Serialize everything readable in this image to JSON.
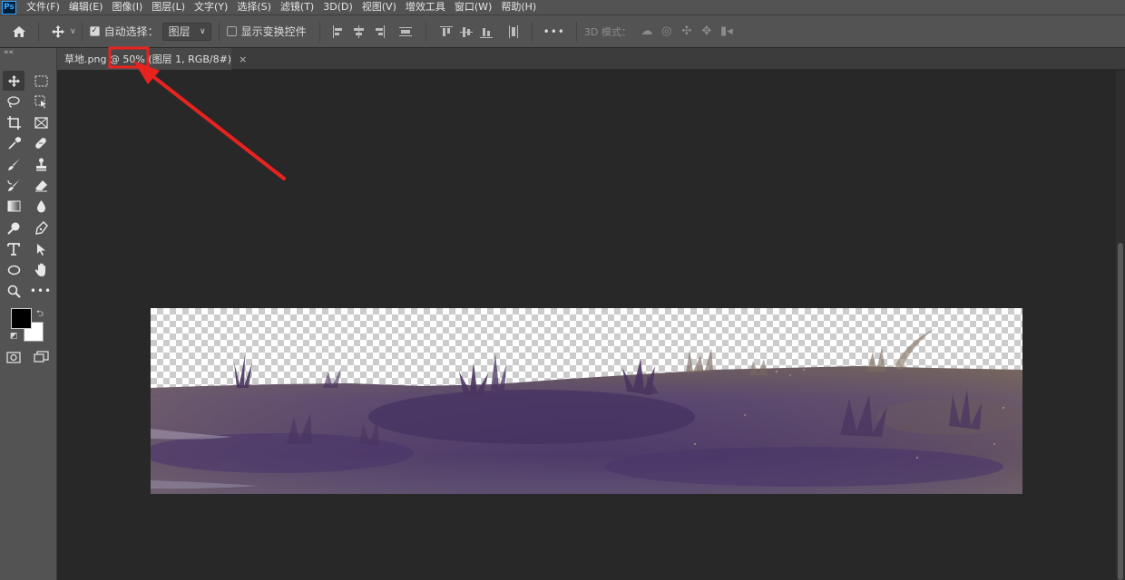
{
  "app": {
    "logo": "Ps"
  },
  "menu": {
    "items": [
      "文件(F)",
      "编辑(E)",
      "图像(I)",
      "图层(L)",
      "文字(Y)",
      "选择(S)",
      "滤镜(T)",
      "3D(D)",
      "视图(V)",
      "增效工具",
      "窗口(W)",
      "帮助(H)"
    ]
  },
  "options": {
    "auto_select_label": "自动选择：",
    "auto_select_checked": true,
    "layer_select_value": "图层",
    "show_transform_label": "显示变换控件",
    "show_transform_checked": false,
    "more_label": "•••",
    "mode_3d_label": "3D 模式："
  },
  "document": {
    "tab_title": "草地.png @ 50% (图层 1, RGB/8#)",
    "close_label": "×"
  },
  "toolbar": {
    "grip": "««"
  },
  "colors": {
    "foreground": "#000000",
    "background": "#ffffff",
    "annotation": "#e8231f",
    "grass": "#4a3560"
  }
}
